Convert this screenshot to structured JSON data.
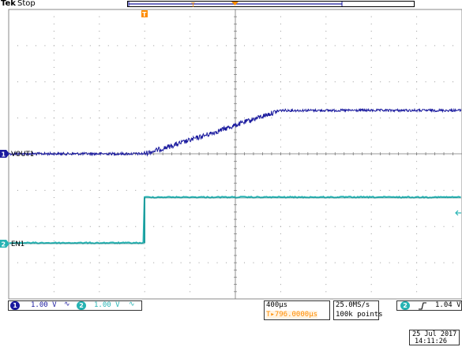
{
  "header": {
    "brand": "Tek",
    "state": "Stop"
  },
  "channels": [
    {
      "id": "1",
      "label": "VOUT1",
      "scale": "1.00 V",
      "color": "#1a1a9e"
    },
    {
      "id": "2",
      "label": "EN1",
      "scale": "1.00 V",
      "color": "#26b3b3"
    }
  ],
  "trigger_marker": "T",
  "trace_colors": {
    "vout": "#1a1a9e",
    "en": "#26b3b3",
    "trigger": "#ff8c00"
  },
  "timebase": {
    "scale": "400µs",
    "position": "796.0000µs",
    "position_prefix": "T▸"
  },
  "acquisition": {
    "rate": "25.0MS/s",
    "points": "100k points"
  },
  "trigger": {
    "channel": "2",
    "slope_icon": "rising-edge",
    "level": "1.04 V"
  },
  "timestamp": {
    "date": "25 Jul 2017",
    "time": "14:11:26"
  }
}
